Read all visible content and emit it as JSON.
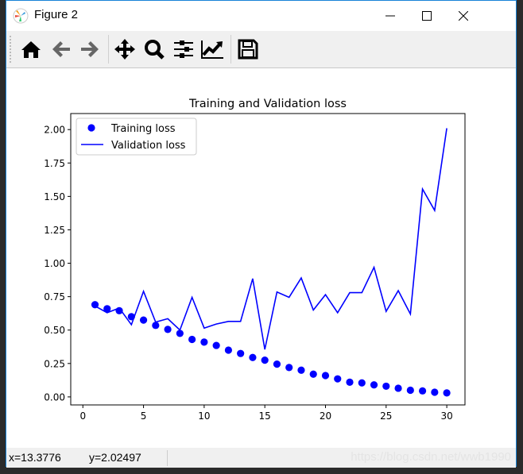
{
  "window": {
    "title": "Figure 2",
    "controls": [
      "minimize",
      "maximize",
      "close"
    ]
  },
  "toolbar": {
    "buttons": [
      {
        "name": "home",
        "icon": "home-icon"
      },
      {
        "name": "back",
        "icon": "arrow-left-icon"
      },
      {
        "name": "forward",
        "icon": "arrow-right-icon"
      },
      {
        "name": "pan",
        "icon": "move-icon"
      },
      {
        "name": "zoom",
        "icon": "magnifier-icon"
      },
      {
        "name": "subplots",
        "icon": "sliders-icon"
      },
      {
        "name": "edit-axis",
        "icon": "chart-line-icon"
      },
      {
        "name": "save",
        "icon": "floppy-icon"
      }
    ]
  },
  "status": {
    "x": "x=13.3776",
    "y": "y=2.02497",
    "watermark": "https://blog.csdn.net/wwb1990"
  },
  "chart_data": {
    "type": "scatter+line",
    "title": "Training and Validation loss",
    "xlabel": "",
    "ylabel": "",
    "xlim": [
      -1,
      31.5
    ],
    "ylim": [
      -0.06,
      2.12
    ],
    "xticks": [
      "0",
      "5",
      "10",
      "15",
      "20",
      "25",
      "30"
    ],
    "yticks": [
      "0.00",
      "0.25",
      "0.50",
      "0.75",
      "1.00",
      "1.25",
      "1.50",
      "1.75",
      "2.00"
    ],
    "grid": false,
    "legend_placement": "upper-left",
    "x": [
      1,
      2,
      3,
      4,
      5,
      6,
      7,
      8,
      9,
      10,
      11,
      12,
      13,
      14,
      15,
      16,
      17,
      18,
      19,
      20,
      21,
      22,
      23,
      24,
      25,
      26,
      27,
      28,
      29,
      30
    ],
    "series": [
      {
        "name": "Training loss",
        "style": "dots",
        "color": "#0000ff",
        "values": [
          0.69,
          0.66,
          0.645,
          0.6,
          0.575,
          0.535,
          0.505,
          0.475,
          0.43,
          0.41,
          0.385,
          0.35,
          0.325,
          0.295,
          0.275,
          0.245,
          0.22,
          0.2,
          0.17,
          0.16,
          0.135,
          0.11,
          0.105,
          0.09,
          0.08,
          0.065,
          0.05,
          0.045,
          0.035,
          0.03
        ]
      },
      {
        "name": "Validation loss",
        "style": "line",
        "color": "#0000ff",
        "values": [
          0.68,
          0.63,
          0.665,
          0.54,
          0.79,
          0.56,
          0.585,
          0.5,
          0.745,
          0.515,
          0.545,
          0.565,
          0.565,
          0.885,
          0.355,
          0.785,
          0.745,
          0.89,
          0.65,
          0.765,
          0.63,
          0.78,
          0.78,
          0.97,
          0.64,
          0.795,
          0.62,
          1.555,
          1.395,
          2.01
        ]
      }
    ]
  }
}
